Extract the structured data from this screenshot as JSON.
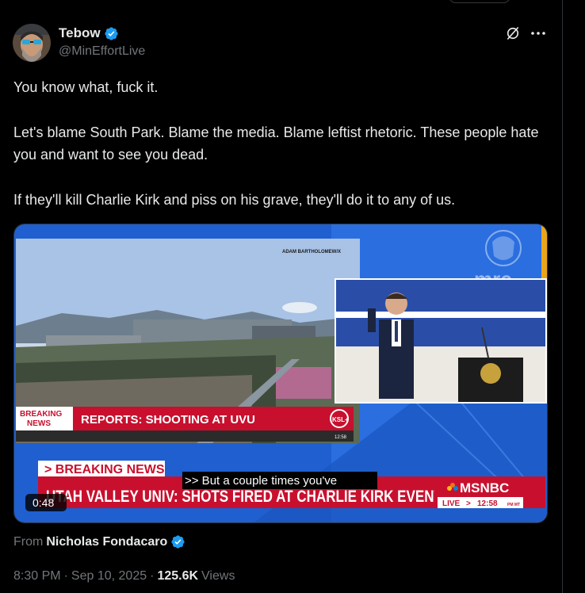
{
  "author": {
    "display_name": "Tebow",
    "handle": "@MinEffortLive",
    "verified": true
  },
  "header_icons": [
    "grok-icon",
    "more-icon"
  ],
  "tweet": {
    "paragraphs": [
      "You know what, fuck it.",
      "Let's blame South Park. Blame the media. Blame leftist rhetoric. These people hate you and want to see you dead.",
      "If they'll kill Charlie Kirk and piss on his grave, they'll do it to any of us."
    ]
  },
  "media": {
    "type": "video",
    "duration": "0:48",
    "photo_credit": "ADAM BARTHOLOMEW/X",
    "inner_breaking_badge": [
      "BREAKING",
      "NEWS"
    ],
    "inner_headline": "REPORTS: SHOOTING AT UVU",
    "inner_station_logo": "KSL+",
    "inner_station_time": "12:58",
    "watermark": "mrc",
    "breaking_tag": "> BREAKING NEWS",
    "main_headline": "UTAH VALLEY UNIV: SHOTS FIRED AT CHARLIE KIRK EVENT",
    "caption": ">> But a couple times you've",
    "network": "MSNBC",
    "live_label": "LIVE",
    "live_arrow": ">",
    "live_time": "12:58",
    "live_zone": "PM MT",
    "colors": {
      "red": "#c8102e",
      "blue": "#1f5fd0",
      "darkblue": "#0f2f73"
    }
  },
  "source": {
    "prefix": "From",
    "name": "Nicholas Fondacaro",
    "verified": true
  },
  "meta": {
    "time": "8:30 PM",
    "separator": "·",
    "date": "Sep 10, 2025",
    "views_count": "125.6K",
    "views_label": "Views"
  },
  "colors": {
    "background": "#000000",
    "text": "#e7e9ea",
    "muted": "#71767b",
    "verified_blue": "#1d9bf0"
  }
}
